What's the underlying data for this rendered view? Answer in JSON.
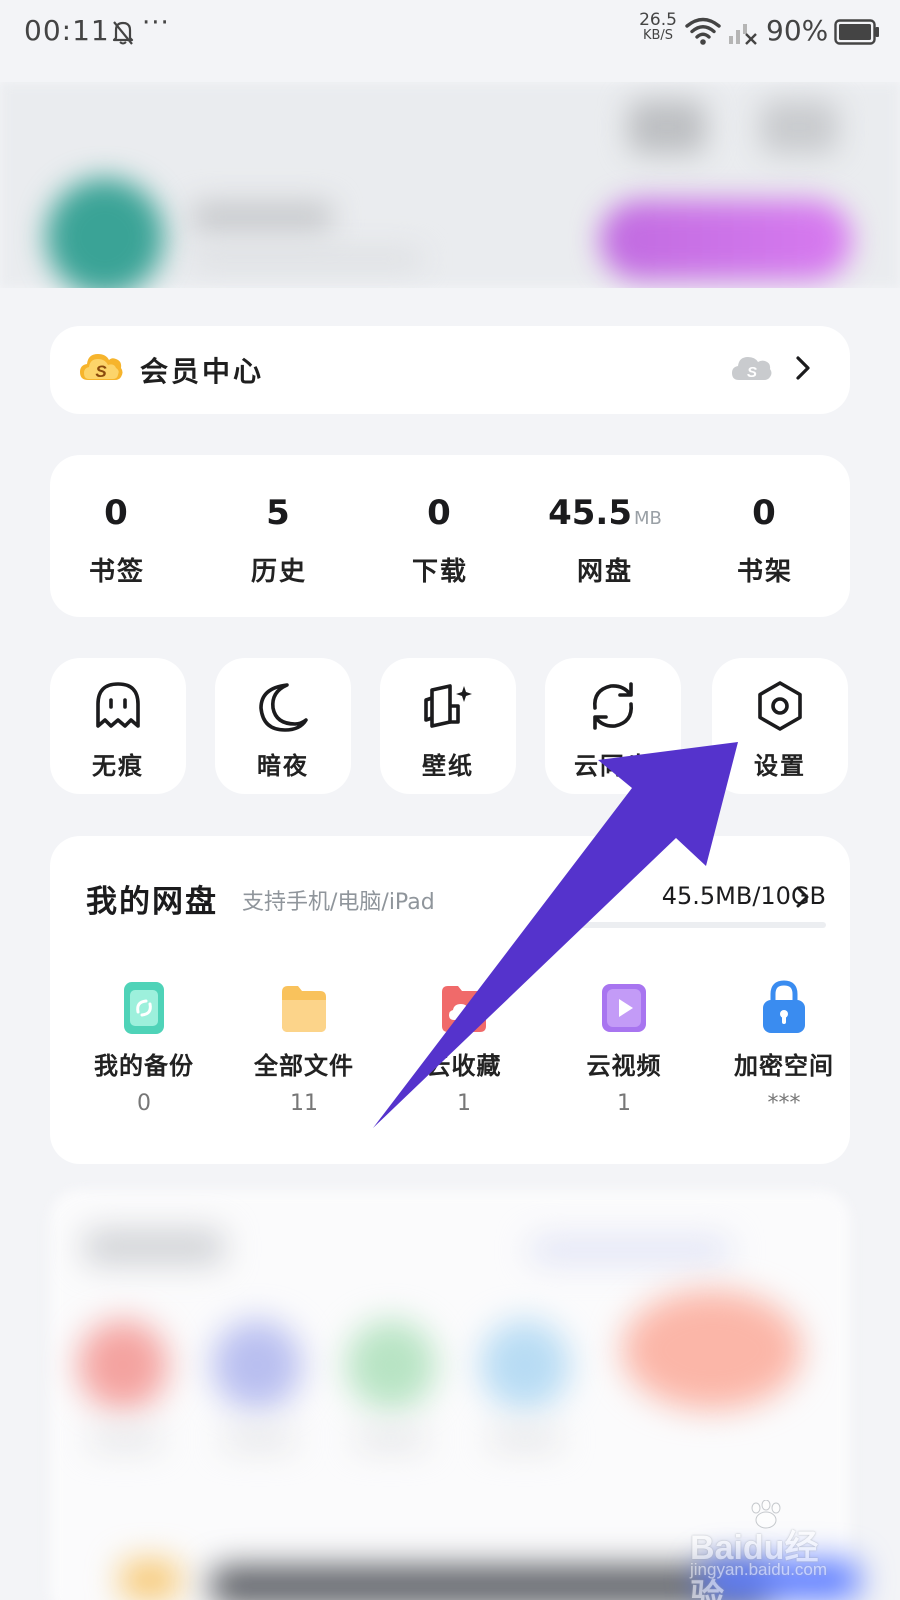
{
  "status_bar": {
    "time": "00:11",
    "more": "···",
    "net_speed_value": "26.5",
    "net_speed_unit": "KB/S",
    "battery": "90%"
  },
  "member": {
    "title": "会员中心"
  },
  "stats": [
    {
      "value": "0",
      "unit": "",
      "label": "书签"
    },
    {
      "value": "5",
      "unit": "",
      "label": "历史"
    },
    {
      "value": "0",
      "unit": "",
      "label": "下载"
    },
    {
      "value": "45.5",
      "unit": "MB",
      "label": "网盘"
    },
    {
      "value": "0",
      "unit": "",
      "label": "书架"
    }
  ],
  "tools": [
    {
      "label": "无痕",
      "icon": "ghost-icon"
    },
    {
      "label": "暗夜",
      "icon": "moon-icon"
    },
    {
      "label": "壁纸",
      "icon": "wallpaper-icon"
    },
    {
      "label": "云同步",
      "icon": "sync-icon"
    },
    {
      "label": "设置",
      "icon": "settings-hex-icon"
    }
  ],
  "cloud_disk": {
    "title": "我的网盘",
    "subtitle": "支持手机/电脑/iPad",
    "usage": "45.5MB/10GB",
    "used_fraction": 0.0044,
    "items": [
      {
        "label": "我的备份",
        "count": "0",
        "icon": "phone-backup-icon",
        "color": "#4fd3b8"
      },
      {
        "label": "全部文件",
        "count": "11",
        "icon": "folder-icon",
        "color": "#f9c25c"
      },
      {
        "label": "云收藏",
        "count": "1",
        "icon": "cloud-folder-icon",
        "color": "#f06a6a"
      },
      {
        "label": "云视频",
        "count": "1",
        "icon": "video-icon",
        "color": "#a875f0"
      },
      {
        "label": "加密空间",
        "count": "***",
        "icon": "lock-icon",
        "color": "#3a8cf0"
      }
    ]
  },
  "watermark": {
    "brand": "Baidu经验",
    "url": "jingyan.baidu.com"
  },
  "colors": {
    "arrow": "#5533cc",
    "background": "#f3f4f7",
    "card": "#ffffff"
  }
}
